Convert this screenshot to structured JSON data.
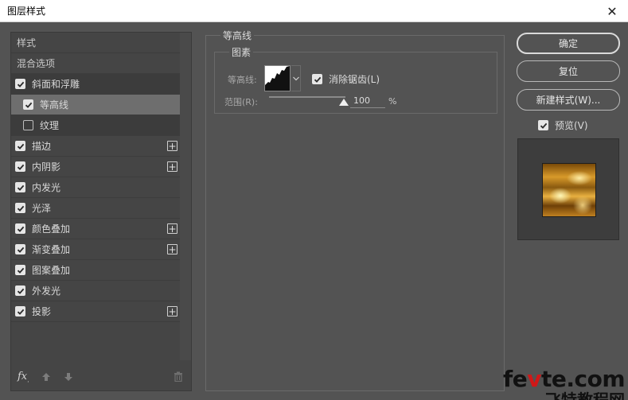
{
  "window": {
    "title": "图层样式",
    "close_icon": "close-icon"
  },
  "left_panel": {
    "items": [
      {
        "label": "样式",
        "type": "plain"
      },
      {
        "label": "混合选项",
        "type": "plain"
      },
      {
        "label": "斜面和浮雕",
        "checked": true,
        "type": "header"
      },
      {
        "label": "等高线",
        "checked": true,
        "type": "sub-selected"
      },
      {
        "label": "纹理",
        "checked": false,
        "type": "sub"
      },
      {
        "label": "描边",
        "checked": true,
        "plus": true
      },
      {
        "label": "内阴影",
        "checked": true,
        "plus": true
      },
      {
        "label": "内发光",
        "checked": true
      },
      {
        "label": "光泽",
        "checked": true
      },
      {
        "label": "颜色叠加",
        "checked": true,
        "plus": true
      },
      {
        "label": "渐变叠加",
        "checked": true,
        "plus": true
      },
      {
        "label": "图案叠加",
        "checked": true
      },
      {
        "label": "外发光",
        "checked": true
      },
      {
        "label": "投影",
        "checked": true,
        "plus": true
      }
    ],
    "footer": {
      "fx_label": "fx",
      "fx_sub": ".",
      "up_icon": "arrow-up-icon",
      "down_icon": "arrow-down-icon",
      "trash_icon": "trash-icon"
    }
  },
  "contour_panel": {
    "section_title": "等高线",
    "group_title": "图素",
    "contour_label": "等高线:",
    "anti_alias_label": "消除锯齿(L)",
    "anti_alias_checked": true,
    "range_label": "范围(R):",
    "range_value": "100",
    "range_unit": "%",
    "range_fraction": 1.0
  },
  "right_panel": {
    "ok_label": "确定",
    "reset_label": "复位",
    "new_style_label": "新建样式(W)...",
    "preview_label": "预览(V)",
    "preview_checked": true
  },
  "watermark": {
    "line1_a": "fe",
    "line1_b": "v",
    "line1_c": "te.com",
    "line2": "飞特教程网"
  },
  "colors": {
    "panel_bg": "#535353",
    "list_bg": "#454545",
    "selected_bg": "#6e6e6e",
    "accent_red": "#d01818"
  }
}
